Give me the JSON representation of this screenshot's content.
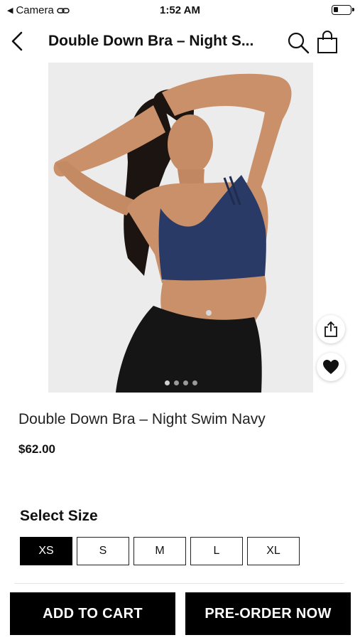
{
  "status_bar": {
    "back_app": "Camera",
    "time": "1:52 AM"
  },
  "header": {
    "title": "Double Down Bra – Night S..."
  },
  "gallery": {
    "dot_count": 4,
    "active_index": 0
  },
  "product": {
    "name": "Double Down Bra – Night Swim Navy",
    "price": "$62.00"
  },
  "size_section": {
    "heading": "Select Size",
    "options": [
      "XS",
      "S",
      "M",
      "L",
      "XL"
    ],
    "selected": "XS"
  },
  "actions": {
    "add_to_cart": "ADD TO CART",
    "pre_order": "PRE-ORDER NOW"
  },
  "colors": {
    "accent": "#000000",
    "bra": "#2a3a66",
    "pants": "#151515",
    "skin": "#c9906a"
  },
  "icons": [
    "back-arrow-icon",
    "search-icon",
    "shopping-bag-icon",
    "share-icon",
    "heart-icon",
    "link-icon"
  ]
}
